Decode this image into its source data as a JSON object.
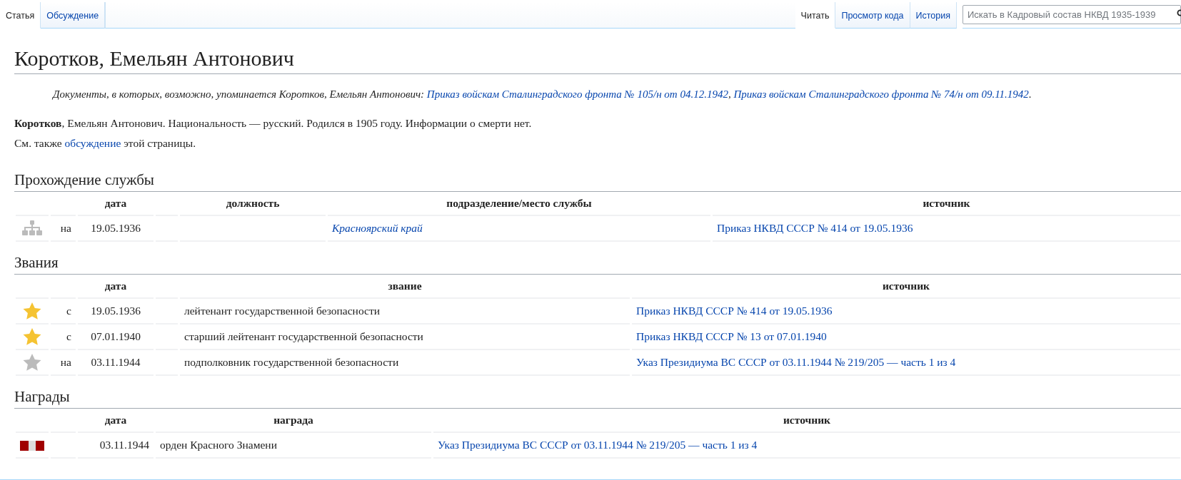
{
  "tabs_left": [
    {
      "label": "Статья",
      "selected": true
    },
    {
      "label": "Обсуждение",
      "selected": false
    }
  ],
  "tabs_right": [
    {
      "label": "Читать",
      "selected": true
    },
    {
      "label": "Просмотр кода",
      "selected": false
    },
    {
      "label": "История",
      "selected": false
    }
  ],
  "search": {
    "placeholder": "Искать в Кадровый состав НКВД 1935-1939"
  },
  "title": "Коротков, Емельян Антонович",
  "hatnote": [
    {
      "kind": "text",
      "text": "Документы, в которых, возможно, упоминается Коротков, Емельян Антонович: "
    },
    {
      "kind": "link",
      "text": "Приказ войскам Сталинградского фронта № 105/н от 04.12.1942"
    },
    {
      "kind": "text",
      "text": ", "
    },
    {
      "kind": "link",
      "text": "Приказ войскам Сталинградского фронта № 74/н от 09.11.1942"
    },
    {
      "kind": "text",
      "text": "."
    }
  ],
  "summary": "**Коротков**, Емельян Антонович. Национальность — русский. Родился в 1905 году. Информации о смерти нет.",
  "see_also": [
    {
      "kind": "text",
      "text": "См. также "
    },
    {
      "kind": "link",
      "text": "обсуждение"
    },
    {
      "kind": "text",
      "text": " этой страницы."
    }
  ],
  "sections": [
    {
      "kind": "service",
      "heading": "Прохождение службы",
      "columns": [
        "дата",
        "должность",
        "подразделение/место службы",
        "источник"
      ],
      "rows": [
        {
          "prefix": "на",
          "date": "19.05.1936",
          "unit": "Красноярский край",
          "source": "Приказ НКВД СССР № 414 от 19.05.1936"
        }
      ]
    },
    {
      "kind": "ranks",
      "heading": "Звания",
      "columns": [
        "дата",
        "звание",
        "источник"
      ],
      "rows": [
        {
          "prefix": "с",
          "date": "19.05.1936",
          "rank": "лейтенант государственной безопасности",
          "source": "Приказ НКВД СССР № 414 от 19.05.1936",
          "color": "#f5c332"
        },
        {
          "prefix": "с",
          "date": "07.01.1940",
          "rank": "старший лейтенант государственной безопасности",
          "source": "Приказ НКВД СССР № 13 от 07.01.1940",
          "color": "#f5c332"
        },
        {
          "prefix": "на",
          "date": "03.11.1944",
          "rank": "подполковник государственной безопасности",
          "source": "Указ Президиума ВС СССР от 03.11.1944 № 219/205 — часть 1 из 4",
          "color": "#bbbbbb"
        }
      ]
    },
    {
      "kind": "awards",
      "heading": "Награды",
      "columns": [
        "дата",
        "награда",
        "источник"
      ],
      "rows": [
        {
          "date": "03.11.1944",
          "award": "орден Красного Знамени",
          "source": "Указ Президиума ВС СССР от 03.11.1944 № 219/205 — часть 1 из 4"
        }
      ]
    }
  ]
}
